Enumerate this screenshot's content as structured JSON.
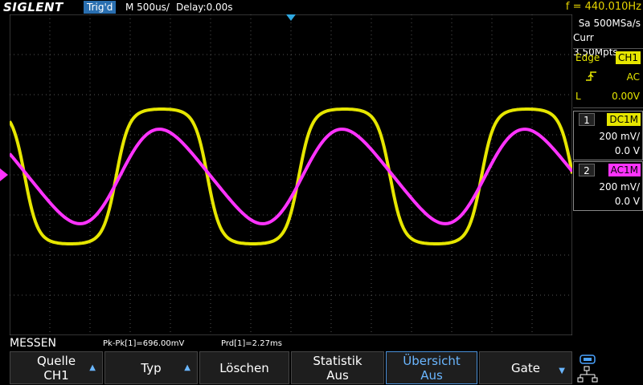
{
  "topbar": {
    "brand": "SIGLENT",
    "trigger_status": "Trig'd",
    "timebase": "M 500us/",
    "delay": "Delay:0.00s",
    "frequency": "f = 440.010Hz"
  },
  "acquisition": {
    "sample_rate": "Sa 500MSa/s",
    "memory": "Curr 3.50Mpts"
  },
  "trigger": {
    "type_label": "Edge",
    "source": "CH1",
    "coupling": "AC",
    "level_label": "L",
    "level_value": "0.00V"
  },
  "channels": [
    {
      "num": "1",
      "coupling": "DC1M",
      "scale": "200 mV/",
      "offset": "0.0 V",
      "color": "#e6e600"
    },
    {
      "num": "2",
      "coupling": "AC1M",
      "scale": "200 mV/",
      "offset": "0.0 V",
      "color": "#ff33ff"
    }
  ],
  "measure": {
    "title": "MESSEN",
    "pkpk": "Pk-Pk[1]=696.00mV",
    "period": "Prd[1]=2.27ms"
  },
  "menu": [
    {
      "line1": "Quelle",
      "line2": "CH1",
      "arrow": true,
      "active": false
    },
    {
      "line1": "Typ",
      "line2": "",
      "arrow": true,
      "active": false
    },
    {
      "line1": "Löschen",
      "line2": "",
      "arrow": false,
      "active": false
    },
    {
      "line1": "Statistik",
      "line2": "Aus",
      "arrow": false,
      "active": false
    },
    {
      "line1": "Übersicht",
      "line2": "Aus",
      "arrow": false,
      "active": true
    },
    {
      "line1": "Gate",
      "line2": "",
      "arrow": true,
      "active": false
    }
  ],
  "colors": {
    "ch1": "#e6e600",
    "ch2": "#ff33ff",
    "accent": "#2a6fb0",
    "frequency": "#e6d400"
  }
}
